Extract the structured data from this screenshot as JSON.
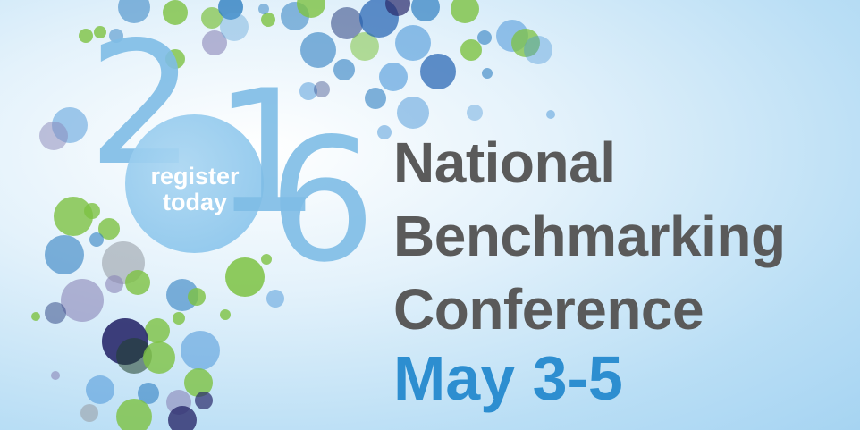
{
  "banner": {
    "year_digits": [
      "2",
      "1",
      "6"
    ],
    "register_line1": "register",
    "register_line2": "today",
    "title_lines": [
      "National",
      "Benchmarking",
      "Conference"
    ],
    "date": "May 3-5"
  },
  "colors": {
    "title": "#5a5a5a",
    "date": "#2d8ed0",
    "year": "#7fbde6",
    "bubble_green": "#7dc242",
    "bubble_blue": "#2f7fc1",
    "bubble_navy": "#2a2a6b",
    "bubble_grey": "#9aa0a8"
  }
}
